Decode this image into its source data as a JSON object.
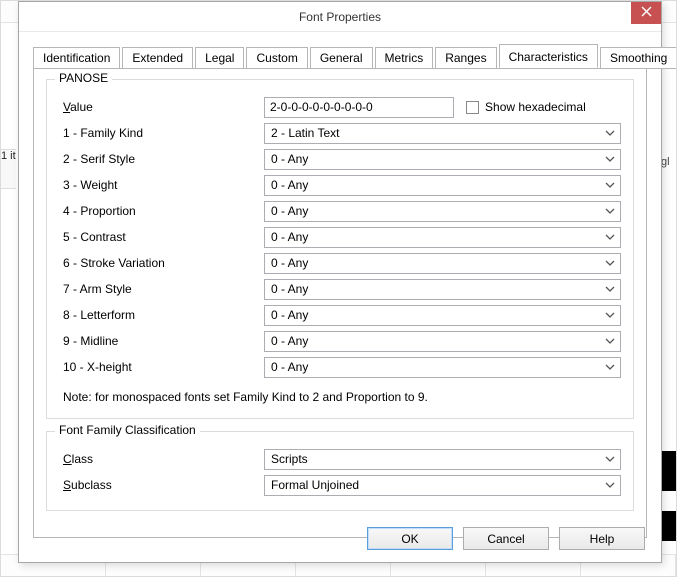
{
  "window": {
    "title": "Font Properties"
  },
  "tabs": [
    {
      "label": "Identification"
    },
    {
      "label": "Extended"
    },
    {
      "label": "Legal"
    },
    {
      "label": "Custom"
    },
    {
      "label": "General"
    },
    {
      "label": "Metrics"
    },
    {
      "label": "Ranges"
    },
    {
      "label": "Characteristics"
    },
    {
      "label": "Smoothing"
    }
  ],
  "active_tab": "Characteristics",
  "panose": {
    "group_title": "PANOSE",
    "value_label_pre": "V",
    "value_label_post": "alue",
    "value": "2-0-0-0-0-0-0-0-0-0",
    "show_hex_pre": "S",
    "show_hex_post": "how hexadecimal",
    "show_hex_checked": false,
    "rows": [
      {
        "label": "1 - Family Kind",
        "selected": "2 - Latin Text"
      },
      {
        "label": "2 - Serif Style",
        "selected": "0 - Any"
      },
      {
        "label": "3 - Weight",
        "selected": "0 - Any"
      },
      {
        "label": "4 - Proportion",
        "selected": "0 - Any"
      },
      {
        "label": "5 - Contrast",
        "selected": "0 - Any"
      },
      {
        "label": "6 - Stroke Variation",
        "selected": "0 - Any"
      },
      {
        "label": "7 - Arm Style",
        "selected": "0 - Any"
      },
      {
        "label": "8 - Letterform",
        "selected": "0 - Any"
      },
      {
        "label": "9 - Midline",
        "selected": "0 - Any"
      },
      {
        "label": "10 - X-height",
        "selected": "0 - Any"
      }
    ],
    "note": "Note: for monospaced fonts set Family Kind to 2 and Proportion to 9."
  },
  "ffc": {
    "group_title": "Font Family Classification",
    "class_label_pre": "C",
    "class_label_post": "lass",
    "class_value": "Scripts",
    "subclass_label_pre": "S",
    "subclass_label_post": "ubclass",
    "subclass_value": "Formal Unjoined"
  },
  "buttons": {
    "ok": "OK",
    "cancel": "Cancel",
    "help": "Help"
  },
  "background": {
    "side_left": "1 it",
    "side_right": "gl"
  }
}
